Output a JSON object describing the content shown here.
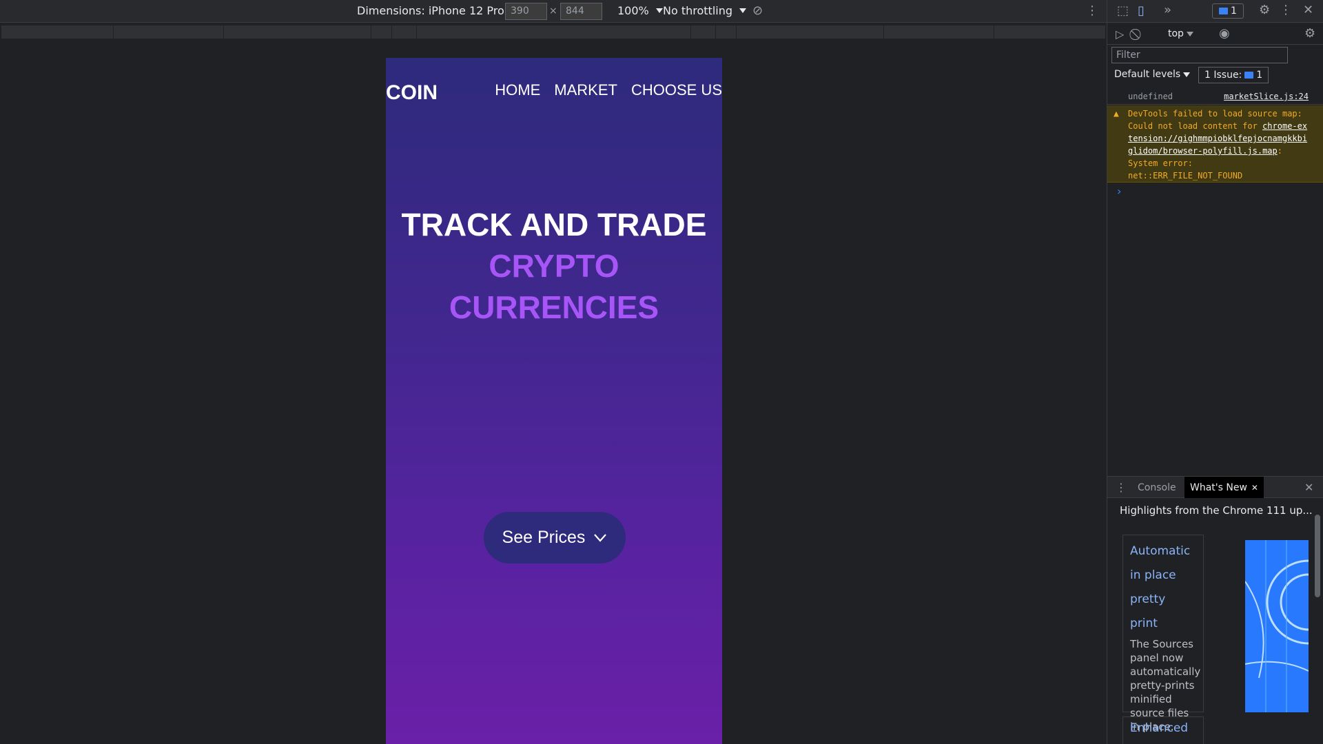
{
  "device_toolbar": {
    "dimensions_label": "Dimensions: iPhone 12 Pro",
    "width": "390",
    "times": "×",
    "height": "844",
    "zoom": "100%",
    "throttling": "No throttling"
  },
  "app": {
    "logo": "COIN",
    "nav": [
      "HOME",
      "MARKET",
      "CHOOSE US"
    ],
    "hero_title": "TRACK AND TRADE",
    "hero_subtitle": "CRYPTO CURRENCIES",
    "cta_label": "See Prices",
    "colors": {
      "accent": "#a855f7",
      "button_bg": "#2e2a7c",
      "gradient_top": "#2e2a7c",
      "gradient_bottom": "#6a20a8"
    }
  },
  "devtools": {
    "issues_badge": "1",
    "context": "top",
    "filter_placeholder": "Filter",
    "levels": "Default levels",
    "issue_count_label": "1 Issue:",
    "issue_count": "1",
    "log": {
      "value": "undefined",
      "source": "marketSlice.js:24"
    },
    "warning": {
      "prefix": "DevTools failed to load source map: Could not load content for ",
      "link": "chrome-extension://gighmmpiobklfepjocnamgkkbiglidom/browser-polyfill.js.map",
      "suffix": ": System error: net::ERR_FILE_NOT_FOUND"
    },
    "drawer": {
      "tabs": [
        "Console",
        "What's New"
      ],
      "whats_new_heading": "Highlights from the Chrome 111 up...",
      "card_title_lines": [
        "Automatic",
        "in place",
        "pretty print"
      ],
      "card_desc": "The Sources panel now automatically pretty-prints minified source files in place.",
      "next_card_title": "Enhanced"
    }
  }
}
